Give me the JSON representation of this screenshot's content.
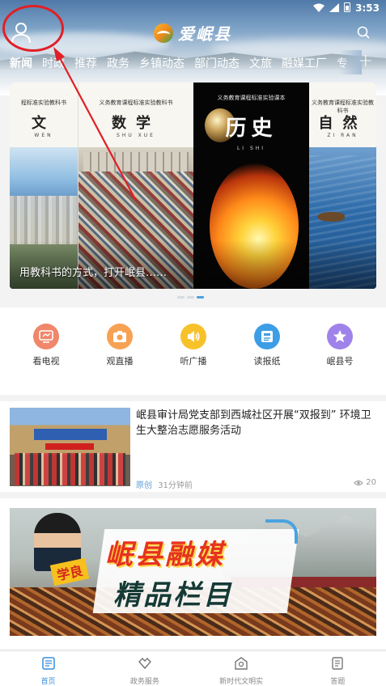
{
  "status_bar": {
    "time": "3:53"
  },
  "header": {
    "app_name": "爱岷县",
    "tabs": [
      "新闻",
      "时政",
      "推荐",
      "政务",
      "乡镇动态",
      "部门动态",
      "文旅",
      "融媒工厂",
      "专"
    ],
    "active_tab": 0
  },
  "carousel": {
    "caption": "用教科书的方式，打开岷县……",
    "books": [
      {
        "series": "程标准实验教科书",
        "subject": "文",
        "pinyin": "WEN"
      },
      {
        "series": "义务教育课程标准实验教科书",
        "subject": "数学",
        "pinyin": "SHU XUE"
      },
      {
        "series": "义务教育课程标准实验课本",
        "subject": "历史",
        "pinyin": "LI SHI"
      },
      {
        "series": "义务教育课程标准实验教科书",
        "subject": "自然",
        "pinyin": "ZI RAN"
      }
    ],
    "active_page": 2,
    "page_count": 3
  },
  "quick_nav": [
    {
      "label": "看电视",
      "color": "#f0866a",
      "icon": "tv-icon"
    },
    {
      "label": "观直播",
      "color": "#f7a253",
      "icon": "camera-icon"
    },
    {
      "label": "听广播",
      "color": "#f7c12a",
      "icon": "speaker-icon"
    },
    {
      "label": "读报纸",
      "color": "#3d9ee6",
      "icon": "newspaper-icon"
    },
    {
      "label": "岷县号",
      "color": "#9f83ea",
      "icon": "star-icon"
    }
  ],
  "news": {
    "title": "岷县审计局党支部到西城社区开展“双报到” 环境卫生大整治志愿服务活动",
    "tag": "原创",
    "time": "31分钟前",
    "views": "20"
  },
  "feature": {
    "title_line1": "岷县融媒",
    "title_line2": "精品栏目",
    "tag": "学良"
  },
  "bottom_nav": [
    {
      "label": "首页",
      "icon": "home-news-icon"
    },
    {
      "label": "政务服务",
      "icon": "handshake-icon"
    },
    {
      "label": "新时代文明实",
      "icon": "civilization-icon"
    },
    {
      "label": "答题",
      "icon": "quiz-icon"
    }
  ],
  "colors": {
    "active_blue": "#3a8fd8",
    "annotation_red": "#e11f26"
  }
}
